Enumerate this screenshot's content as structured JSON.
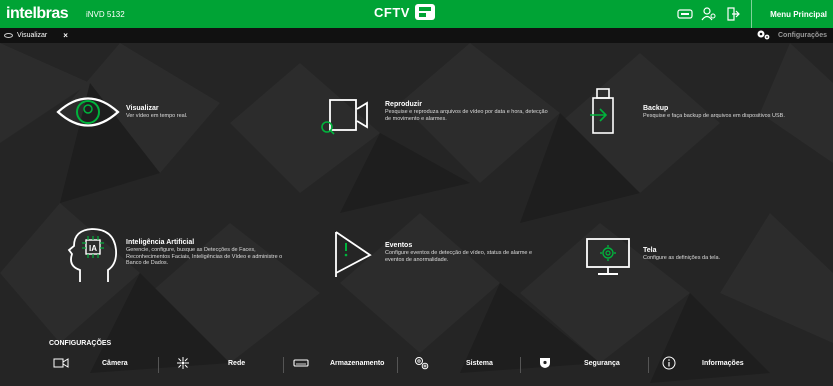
{
  "header": {
    "brand": "intelbras",
    "model": "iNVD 5132",
    "app_title": "CFTV",
    "menu_principal": "Menu Principal",
    "icons": [
      "network-status-icon",
      "users-icon",
      "logout-icon"
    ]
  },
  "tabs": {
    "active_tab": "Visualizar",
    "close_symbol": "×",
    "config_link": "Configurações"
  },
  "tiles": {
    "visualizar": {
      "title": "Visualizar",
      "description": "Ver vídeo em tempo real."
    },
    "reproduzir": {
      "title": "Reproduzir",
      "description": "Pesquise e reproduza arquivos de vídeo por data e hora, detecção de movimento e alarmes."
    },
    "backup": {
      "title": "Backup",
      "description": "Pesquise e faça backup de arquivos em dispositivos USB."
    },
    "ia": {
      "title": "Inteligência Artificial",
      "description": "Gerencie, configure, busque as Detecções de Faces, Reconhecimentos Faciais, Inteligências de Vídeo e administre o Banco de Dados.",
      "icon_text": "IA"
    },
    "eventos": {
      "title": "Eventos",
      "description": "Configure eventos de detecção de vídeo, status de alarme e eventos de anormalidade."
    },
    "tela": {
      "title": "Tela",
      "description": "Configure as definições da tela."
    }
  },
  "config": {
    "heading": "CONFIGURAÇÕES",
    "items": [
      {
        "label": "Câmera",
        "icon": "camera-icon"
      },
      {
        "label": "Rede",
        "icon": "network-icon"
      },
      {
        "label": "Armazenamento",
        "icon": "storage-icon"
      },
      {
        "label": "Sistema",
        "icon": "system-gears-icon"
      },
      {
        "label": "Segurança",
        "icon": "shield-icon"
      },
      {
        "label": "Informações",
        "icon": "info-icon"
      }
    ]
  },
  "colors": {
    "brand_green": "#00a335",
    "background": "#232323",
    "accent_icon": "#00b33c"
  }
}
